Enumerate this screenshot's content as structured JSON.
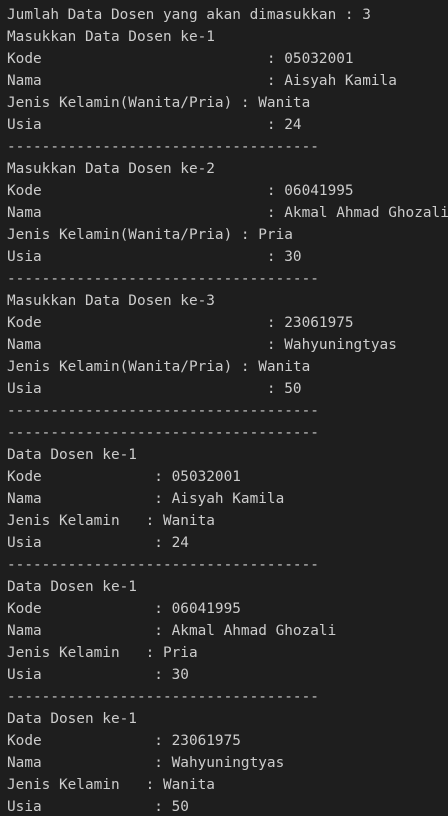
{
  "terminal": {
    "lines": [
      "Jumlah Data Dosen yang akan dimasukkan : 3",
      "Masukkan Data Dosen ke-1",
      "Kode                          : 05032001",
      "Nama                          : Aisyah Kamila",
      "Jenis Kelamin(Wanita/Pria) : Wanita",
      "Usia                          : 24",
      "------------------------------------",
      "Masukkan Data Dosen ke-2",
      "Kode                          : 06041995",
      "Nama                          : Akmal Ahmad Ghozali",
      "Jenis Kelamin(Wanita/Pria) : Pria",
      "Usia                          : 30",
      "------------------------------------",
      "Masukkan Data Dosen ke-3",
      "Kode                          : 23061975",
      "Nama                          : Wahyuningtyas",
      "Jenis Kelamin(Wanita/Pria) : Wanita",
      "Usia                          : 50",
      "------------------------------------",
      "------------------------------------",
      "Data Dosen ke-1",
      "Kode             : 05032001",
      "Nama             : Aisyah Kamila",
      "Jenis Kelamin   : Wanita",
      "Usia             : 24",
      "------------------------------------",
      "Data Dosen ke-1",
      "Kode             : 06041995",
      "Nama             : Akmal Ahmad Ghozali",
      "Jenis Kelamin   : Pria",
      "Usia             : 30",
      "------------------------------------",
      "Data Dosen ke-1",
      "Kode             : 23061975",
      "Nama             : Wahyuningtyas",
      "Jenis Kelamin   : Wanita",
      "Usia             : 50"
    ],
    "colors": {
      "background": "#1e1e1e",
      "foreground": "#cccccc"
    }
  }
}
